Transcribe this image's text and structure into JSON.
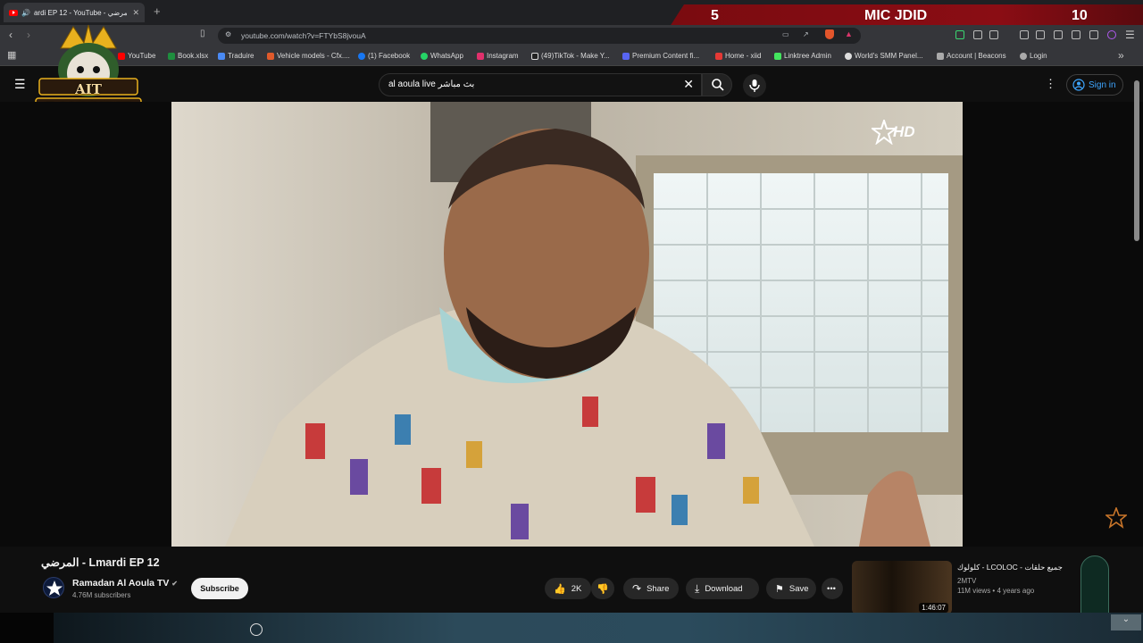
{
  "browser": {
    "tab_title": "ardi EP 12 - YouTube - المرضي",
    "url": "youtube.com/watch?v=FTYbS8jvouA",
    "bookmarks": [
      {
        "label": "YouTube",
        "color": "#ff0000"
      },
      {
        "label": "Book.xlsx",
        "color": "#1e8e3e"
      },
      {
        "label": "Traduire",
        "color": "#4a8af4"
      },
      {
        "label": "Vehicle models - Cfx....",
        "color": "#e05a2b"
      },
      {
        "label": "(1) Facebook",
        "color": "#1877f2"
      },
      {
        "label": "WhatsApp",
        "color": "#25d366"
      },
      {
        "label": "Instagram",
        "color": "#e1306c"
      },
      {
        "label": "(49)TikTok - Make Y...",
        "color": "#dddddd"
      },
      {
        "label": "Premium Content fi...",
        "color": "#5865f2"
      },
      {
        "label": "Home - xiid",
        "color": "#e53935"
      },
      {
        "label": "Linktree Admin",
        "color": "#43e55e"
      },
      {
        "label": "World's SMM Panel...",
        "color": "#dddddd"
      },
      {
        "label": "Account | Beacons",
        "color": "#aaaaaa"
      },
      {
        "label": "Login",
        "color": "#aaaaaa"
      }
    ]
  },
  "overlay": {
    "score": "5",
    "team": "MIC JDID",
    "time": "10",
    "logo_text": "AIT BOUKHRIZ"
  },
  "youtube": {
    "search_value": "al aoula live بث مباشر",
    "signin_label": "Sign in",
    "hd_badge": "HD",
    "video_title": "المرضي - Lmardi EP 12",
    "channel_name": "Ramadan Al Aoula TV",
    "subscribers": "4.76M subscribers",
    "subscribe_label": "Subscribe",
    "likes": "2K",
    "share_label": "Share",
    "download_label": "Download",
    "save_label": "Save",
    "recommended": {
      "title": "كلولوك - LCOLOC - جميع حلقات",
      "channel": "2MTV",
      "meta": "11M views • 4 years ago",
      "duration": "1:46:07"
    }
  }
}
